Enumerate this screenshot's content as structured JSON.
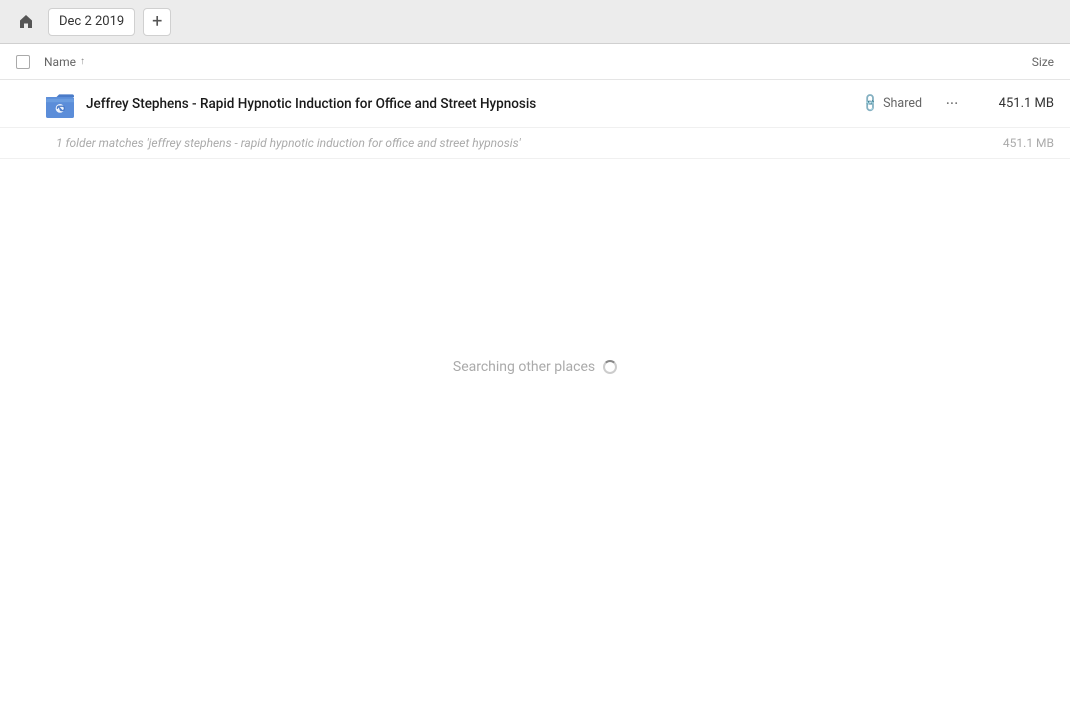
{
  "topbar": {
    "breadcrumb": "Dec 2 2019",
    "add_button_label": "+"
  },
  "columns": {
    "name_label": "Name",
    "size_label": "Size"
  },
  "file_row": {
    "name": "Jeffrey Stephens - Rapid Hypnotic Induction for Office and Street Hypnosis",
    "shared_label": "Shared",
    "size": "451.1 MB",
    "more_icon": "•••"
  },
  "summary": {
    "text": "1 folder matches 'jeffrey stephens - rapid hypnotic induction for office and street hypnosis'",
    "size": "451.1 MB"
  },
  "searching": {
    "text": "Searching other places"
  },
  "icons": {
    "home": "⌂",
    "link": "🔗",
    "sort_asc": "↑"
  }
}
